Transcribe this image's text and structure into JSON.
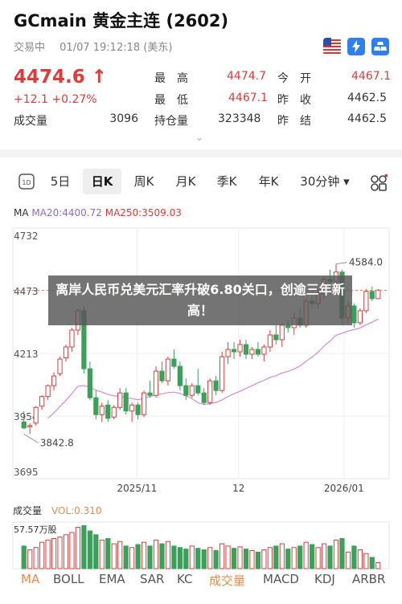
{
  "header": {
    "title": "GCmain  黄金主连 (2602)",
    "status": "交易中",
    "datetime": "01/07 19:12:18 (美东)",
    "price": "4474.6",
    "change": "+12.1",
    "change_pct": "+0.27%",
    "volume_label": "成交量",
    "volume_value": "3096",
    "high_label": "最　高",
    "high_value": "4474.7",
    "low_label": "最　低",
    "low_value": "4467.1",
    "oi_label": "持仓量",
    "oi_value": "323348",
    "open_label": "今　开",
    "open_value": "4467.1",
    "prev_close_label": "昨　收",
    "prev_close_value": "4462.5",
    "prev_settle_label": "昨　结",
    "prev_settle_value": "4462.5"
  },
  "tabs": [
    "5日",
    "日K",
    "周K",
    "月K",
    "季K",
    "年K",
    "30分钟 ▾"
  ],
  "active_tab": "日K",
  "ma": {
    "label": "MA",
    "ma20": "MA20:4400.72",
    "ma250": "MA250:3509.03"
  },
  "axis": {
    "y_ticks": [
      "4732",
      "4473",
      "4213",
      "3954",
      "3695"
    ],
    "x_ticks": [
      "2025/11",
      "12",
      "2026/01"
    ],
    "max_label": "4584.0",
    "min_label": "3842.8"
  },
  "volume_panel": {
    "label": "成交量",
    "vol": "VOL:0.310",
    "max": "57.57万股"
  },
  "indicators": [
    "MA",
    "BOLL",
    "EMA",
    "SAR",
    "KC",
    "成交量",
    "MACD",
    "KDJ",
    "ARBR"
  ],
  "active_indicator": "成交量",
  "headline": "离岸人民币兑美元汇率升破6.80关口，创逾三年新高！",
  "colors": {
    "up": "#e03a3a",
    "down": "#3aa05a",
    "ma20": "#8b6ad0",
    "ma250": "#e03a3a"
  },
  "chart_data": {
    "type": "candlestick",
    "ylim": [
      3695,
      4732
    ],
    "candles": [
      [
        3930,
        3975,
        3900,
        3905
      ],
      [
        3910,
        3925,
        3880,
        3915
      ],
      [
        3925,
        3995,
        3915,
        3990
      ],
      [
        3995,
        4040,
        3980,
        4035
      ],
      [
        4035,
        4085,
        4020,
        4080
      ],
      [
        4080,
        4135,
        4060,
        4120
      ],
      [
        4130,
        4200,
        4120,
        4190
      ],
      [
        4195,
        4250,
        4180,
        4240
      ],
      [
        4240,
        4320,
        4220,
        4310
      ],
      [
        4310,
        4400,
        4290,
        4390
      ],
      [
        4390,
        4410,
        4130,
        4150
      ],
      [
        4150,
        4180,
        4020,
        4030
      ],
      [
        4030,
        4060,
        3940,
        3960
      ],
      [
        3960,
        4010,
        3930,
        3995
      ],
      [
        4000,
        4020,
        3930,
        3945
      ],
      [
        3950,
        4000,
        3940,
        3990
      ],
      [
        3990,
        4070,
        3980,
        4050
      ],
      [
        4050,
        4070,
        3960,
        3975
      ],
      [
        3975,
        4010,
        3930,
        4000
      ],
      [
        4000,
        4010,
        3940,
        3960
      ],
      [
        3960,
        4060,
        3950,
        4050
      ],
      [
        4050,
        4100,
        4030,
        4040
      ],
      [
        4040,
        4160,
        4030,
        4140
      ],
      [
        4140,
        4180,
        4090,
        4100
      ],
      [
        4100,
        4200,
        4080,
        4190
      ],
      [
        4190,
        4230,
        4150,
        4160
      ],
      [
        4160,
        4180,
        4060,
        4080
      ],
      [
        4080,
        4110,
        4020,
        4040
      ],
      [
        4040,
        4090,
        4030,
        4080
      ],
      [
        4080,
        4150,
        4040,
        4050
      ],
      [
        4050,
        4070,
        4000,
        4010
      ],
      [
        4010,
        4110,
        4000,
        4100
      ],
      [
        4100,
        4120,
        4040,
        4060
      ],
      [
        4060,
        4220,
        4050,
        4200
      ],
      [
        4200,
        4260,
        4170,
        4230
      ],
      [
        4230,
        4260,
        4190,
        4220
      ],
      [
        4220,
        4270,
        4200,
        4250
      ],
      [
        4250,
        4270,
        4190,
        4210
      ],
      [
        4210,
        4240,
        4190,
        4230
      ],
      [
        4230,
        4260,
        4200,
        4210
      ],
      [
        4210,
        4250,
        4180,
        4240
      ],
      [
        4240,
        4310,
        4220,
        4290
      ],
      [
        4290,
        4330,
        4250,
        4270
      ],
      [
        4270,
        4340,
        4240,
        4330
      ],
      [
        4330,
        4350,
        4300,
        4320
      ],
      [
        4320,
        4380,
        4290,
        4360
      ],
      [
        4360,
        4400,
        4320,
        4330
      ],
      [
        4330,
        4440,
        4320,
        4430
      ],
      [
        4430,
        4470,
        4400,
        4420
      ],
      [
        4420,
        4480,
        4400,
        4460
      ],
      [
        4460,
        4530,
        4440,
        4520
      ],
      [
        4520,
        4560,
        4490,
        4510
      ],
      [
        4510,
        4584,
        4500,
        4550
      ],
      [
        4550,
        4560,
        4330,
        4360
      ],
      [
        4360,
        4430,
        4340,
        4410
      ],
      [
        4410,
        4420,
        4320,
        4340
      ],
      [
        4340,
        4400,
        4330,
        4390
      ],
      [
        4390,
        4480,
        4380,
        4470
      ],
      [
        4470,
        4490,
        4430,
        4440
      ],
      [
        4440,
        4480,
        4440,
        4475
      ]
    ],
    "volume": [
      30,
      25,
      28,
      35,
      38,
      40,
      42,
      45,
      48,
      55,
      57,
      50,
      45,
      38,
      40,
      33,
      36,
      30,
      28,
      32,
      35,
      30,
      38,
      33,
      36,
      30,
      28,
      26,
      30,
      27,
      25,
      28,
      24,
      33,
      30,
      27,
      29,
      26,
      24,
      22,
      25,
      28,
      30,
      33,
      26,
      28,
      30,
      35,
      32,
      28,
      33,
      30,
      38,
      40,
      22,
      30,
      25,
      20,
      15,
      8
    ]
  }
}
